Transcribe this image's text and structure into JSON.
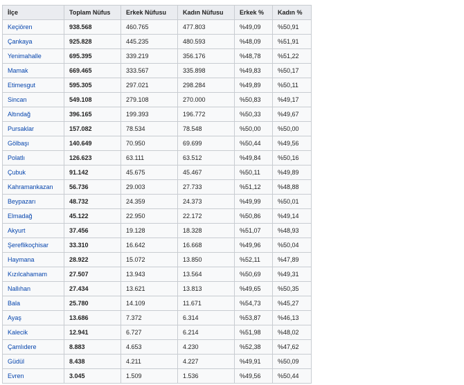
{
  "table": {
    "headers": [
      "İlçe",
      "Toplam Nüfus",
      "Erkek Nüfusu",
      "Kadın Nüfusu",
      "Erkek %",
      "Kadın %"
    ],
    "rows": [
      [
        "Keçiören",
        "938.568",
        "460.765",
        "477.803",
        "%49,09",
        "%50,91"
      ],
      [
        "Çankaya",
        "925.828",
        "445.235",
        "480.593",
        "%48,09",
        "%51,91"
      ],
      [
        "Yenimahalle",
        "695.395",
        "339.219",
        "356.176",
        "%48,78",
        "%51,22"
      ],
      [
        "Mamak",
        "669.465",
        "333.567",
        "335.898",
        "%49,83",
        "%50,17"
      ],
      [
        "Etimesgut",
        "595.305",
        "297.021",
        "298.284",
        "%49,89",
        "%50,11"
      ],
      [
        "Sincan",
        "549.108",
        "279.108",
        "270.000",
        "%50,83",
        "%49,17"
      ],
      [
        "Altındağ",
        "396.165",
        "199.393",
        "196.772",
        "%50,33",
        "%49,67"
      ],
      [
        "Pursaklar",
        "157.082",
        "78.534",
        "78.548",
        "%50,00",
        "%50,00"
      ],
      [
        "Gölbaşı",
        "140.649",
        "70.950",
        "69.699",
        "%50,44",
        "%49,56"
      ],
      [
        "Polatlı",
        "126.623",
        "63.111",
        "63.512",
        "%49,84",
        "%50,16"
      ],
      [
        "Çubuk",
        "91.142",
        "45.675",
        "45.467",
        "%50,11",
        "%49,89"
      ],
      [
        "Kahramankazan",
        "56.736",
        "29.003",
        "27.733",
        "%51,12",
        "%48,88"
      ],
      [
        "Beypazarı",
        "48.732",
        "24.359",
        "24.373",
        "%49,99",
        "%50,01"
      ],
      [
        "Elmadağ",
        "45.122",
        "22.950",
        "22.172",
        "%50,86",
        "%49,14"
      ],
      [
        "Akyurt",
        "37.456",
        "19.128",
        "18.328",
        "%51,07",
        "%48,93"
      ],
      [
        "Şereflikoçhisar",
        "33.310",
        "16.642",
        "16.668",
        "%49,96",
        "%50,04"
      ],
      [
        "Haymana",
        "28.922",
        "15.072",
        "13.850",
        "%52,11",
        "%47,89"
      ],
      [
        "Kızılcahamam",
        "27.507",
        "13.943",
        "13.564",
        "%50,69",
        "%49,31"
      ],
      [
        "Nallıhan",
        "27.434",
        "13.621",
        "13.813",
        "%49,65",
        "%50,35"
      ],
      [
        "Bala",
        "25.780",
        "14.109",
        "11.671",
        "%54,73",
        "%45,27"
      ],
      [
        "Ayaş",
        "13.686",
        "7.372",
        "6.314",
        "%53,87",
        "%46,13"
      ],
      [
        "Kalecik",
        "12.941",
        "6.727",
        "6.214",
        "%51,98",
        "%48,02"
      ],
      [
        "Çamlıdere",
        "8.883",
        "4.653",
        "4.230",
        "%52,38",
        "%47,62"
      ],
      [
        "Güdül",
        "8.438",
        "4.211",
        "4.227",
        "%49,91",
        "%50,09"
      ],
      [
        "Evren",
        "3.045",
        "1.509",
        "1.536",
        "%49,56",
        "%50,44"
      ]
    ]
  }
}
